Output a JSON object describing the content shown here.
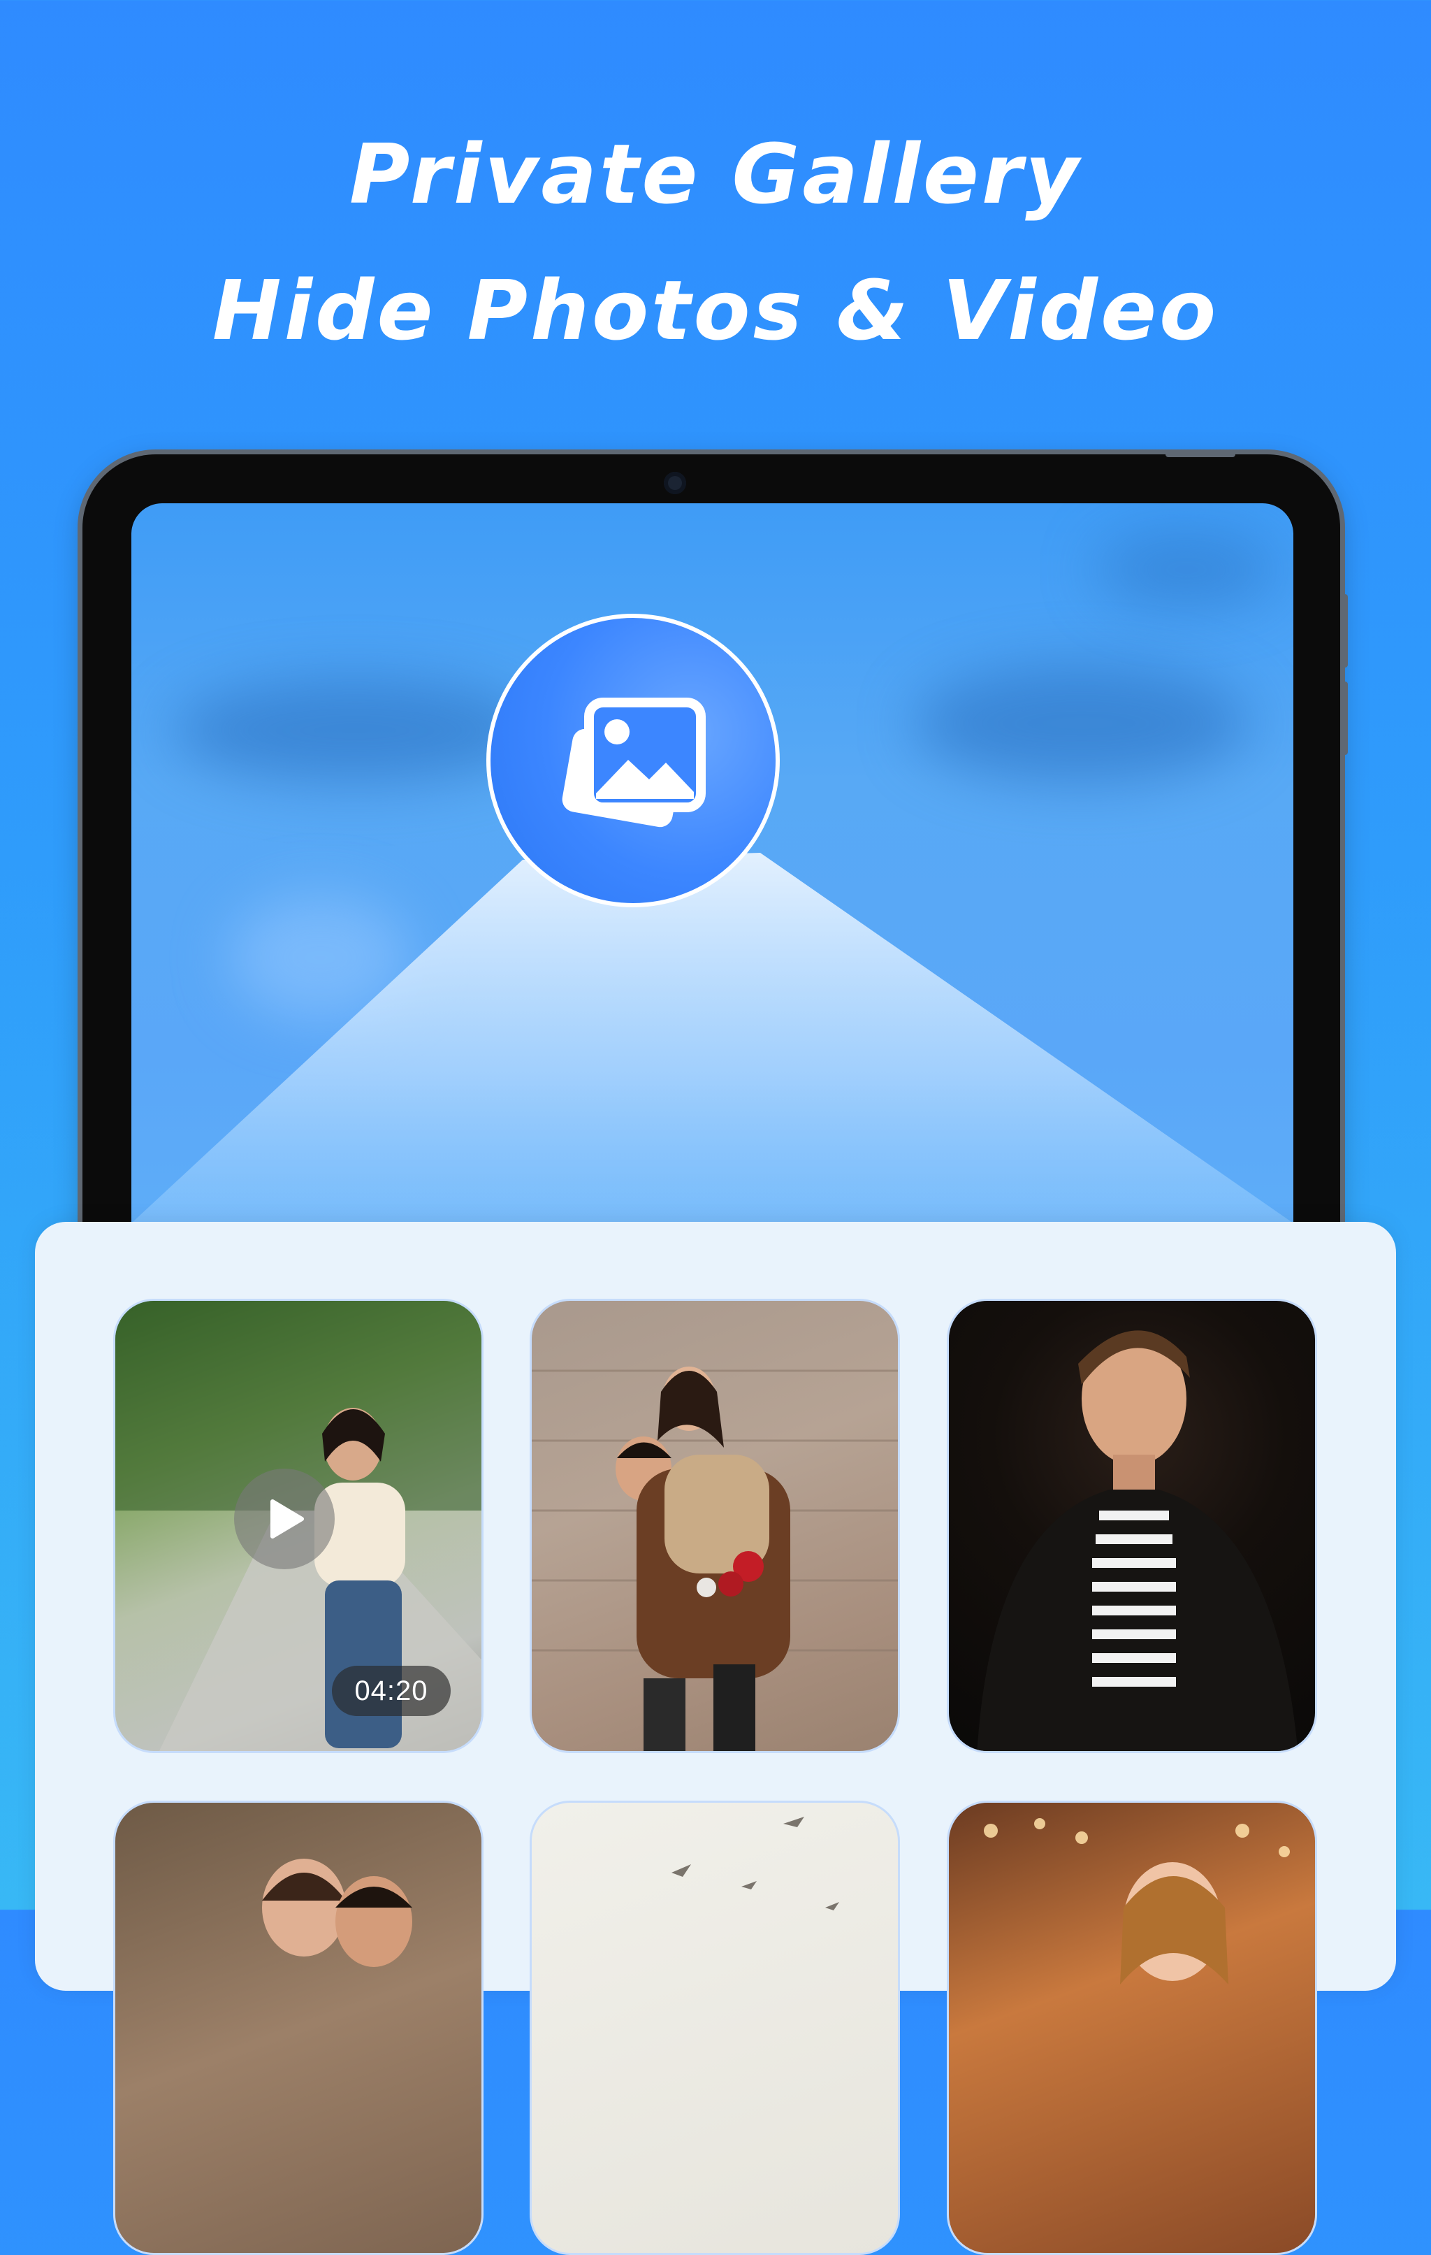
{
  "header": {
    "title_line1": "Private Gallery",
    "title_line2": "Hide Photos & Video"
  },
  "app": {
    "logo_icon": "photo-gallery-icon",
    "accent_color": "#2f8bff"
  },
  "gallery": {
    "items": [
      {
        "type": "video",
        "duration": "04:20",
        "icon": "play-icon"
      },
      {
        "type": "photo"
      },
      {
        "type": "photo"
      },
      {
        "type": "photo"
      },
      {
        "type": "photo"
      },
      {
        "type": "photo"
      }
    ]
  }
}
